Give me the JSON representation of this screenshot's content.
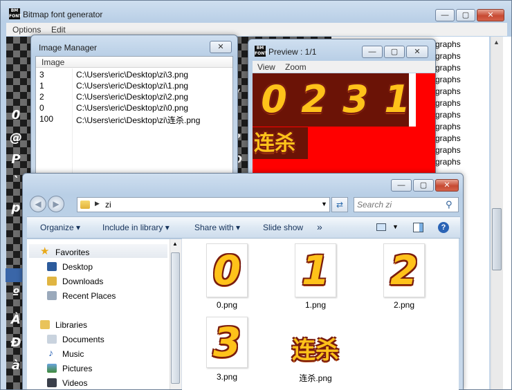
{
  "main_window": {
    "title": "Bitmap font generator",
    "menu": [
      "Options",
      "Edit"
    ],
    "glyphs_left": [
      "0",
      "@",
      "P",
      "`",
      "p",
      "",
      "",
      "º",
      "À",
      "Đ",
      "à",
      ""
    ],
    "glyphs_right": [
      "/",
      "?",
      "O",
      "_",
      "o",
      "",
      "",
      "¿",
      "Ï",
      "ß",
      "ï",
      ""
    ],
    "char_list": [
      "graphs",
      "graphs",
      "graphs",
      "graphs",
      "graphs",
      "graphs",
      "graphs",
      "graphs",
      "graphs",
      "graphs",
      "graphs"
    ]
  },
  "image_manager": {
    "title": "Image Manager",
    "column_header": "Image",
    "rows": [
      {
        "id": "3",
        "path": "C:\\Users\\eric\\Desktop\\zi\\3.png"
      },
      {
        "id": "1",
        "path": "C:\\Users\\eric\\Desktop\\zi\\1.png"
      },
      {
        "id": "2",
        "path": "C:\\Users\\eric\\Desktop\\zi\\2.png"
      },
      {
        "id": "0",
        "path": "C:\\Users\\eric\\Desktop\\zi\\0.png"
      },
      {
        "id": "100",
        "path": "C:\\Users\\eric\\Desktop\\zi\\连杀.png"
      }
    ]
  },
  "preview": {
    "title": "Preview : 1/1",
    "menu": [
      "View",
      "Zoom"
    ],
    "digits": [
      "0",
      "2",
      "3",
      "1"
    ],
    "word": "连杀"
  },
  "explorer": {
    "path_segment": "zi",
    "search_placeholder": "Search zi",
    "toolbar": {
      "organize": "Organize",
      "include_in_library": "Include in library",
      "share_with": "Share with",
      "slide_show": "Slide show",
      "more": "»"
    },
    "nav": {
      "favorites": "Favorites",
      "desktop": "Desktop",
      "downloads": "Downloads",
      "recent_places": "Recent Places",
      "libraries": "Libraries",
      "documents": "Documents",
      "music": "Music",
      "pictures": "Pictures",
      "videos": "Videos"
    },
    "files": [
      {
        "name": "0.png",
        "glyph": "0"
      },
      {
        "name": "1.png",
        "glyph": "1"
      },
      {
        "name": "2.png",
        "glyph": "2"
      },
      {
        "name": "3.png",
        "glyph": "3"
      },
      {
        "name": "连杀.png",
        "glyph": "连杀"
      }
    ]
  },
  "colors": {
    "preview_bg": "#ff0000",
    "glyph_fill": "#ffc21a",
    "glyph_outline": "#7a1d0e",
    "close_button": "#c74a33"
  }
}
